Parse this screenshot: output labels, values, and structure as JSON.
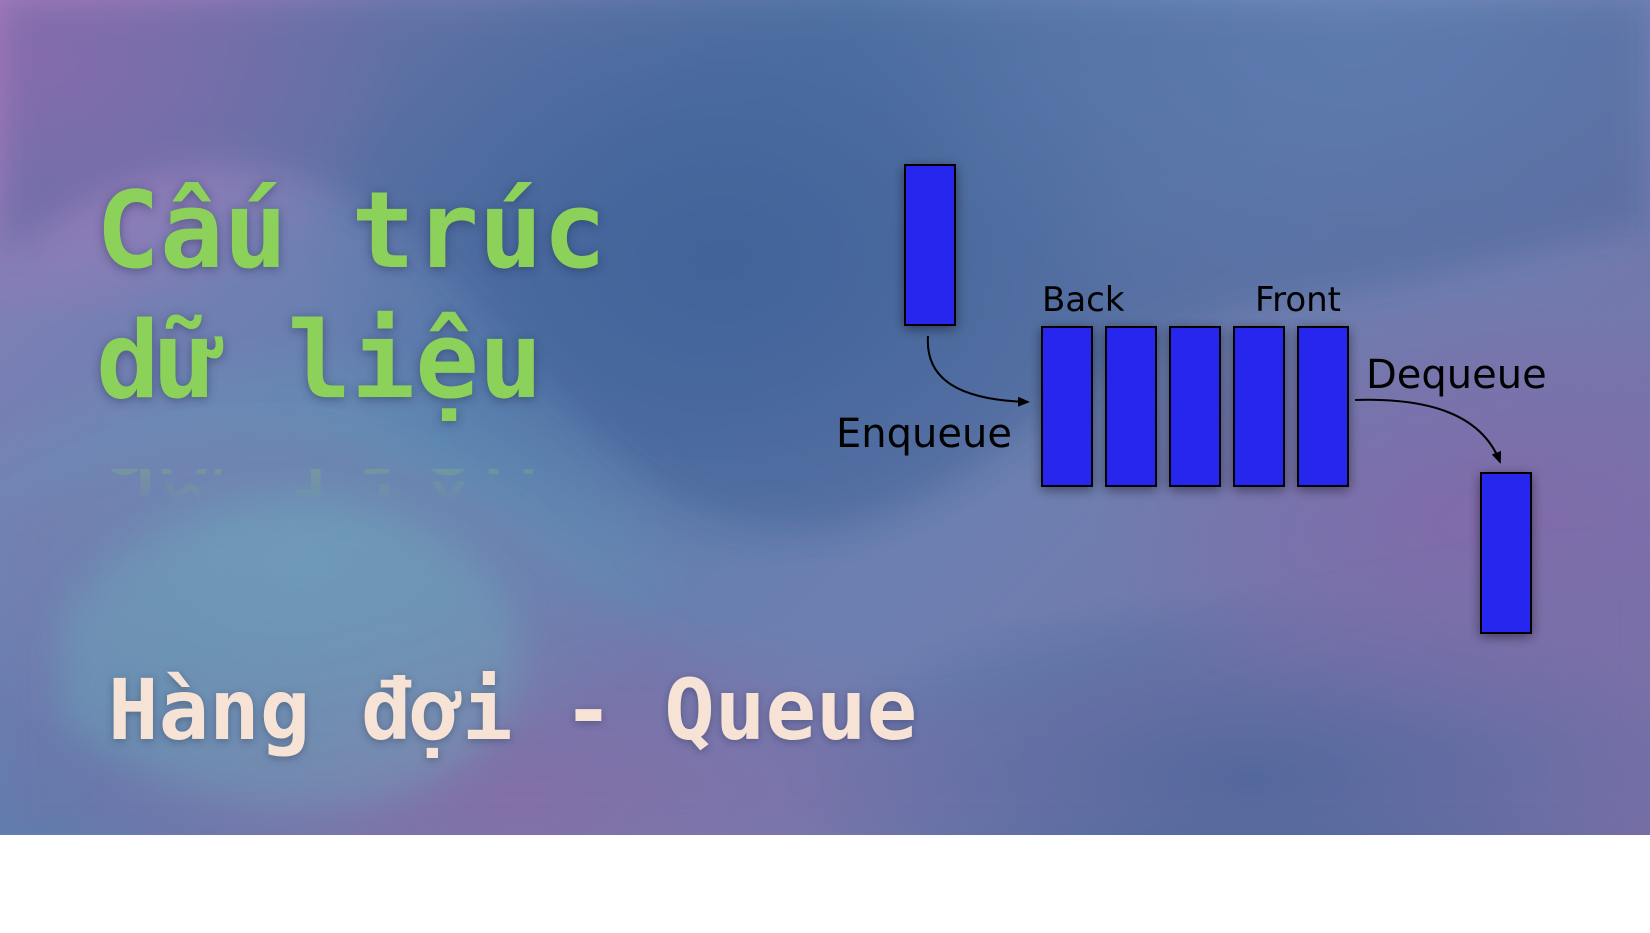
{
  "title": {
    "line1": "Cấu trúc",
    "line2": "dữ liệu"
  },
  "subtitle": "Hàng đợi - Queue",
  "diagram": {
    "back_label": "Back",
    "front_label": "Front",
    "enqueue_label": "Enqueue",
    "dequeue_label": "Dequeue",
    "queue_length": 5
  },
  "colors": {
    "title_green": "#8cd15a",
    "subtitle_cream": "#f7e2d6",
    "block_blue": "#2727ee"
  }
}
